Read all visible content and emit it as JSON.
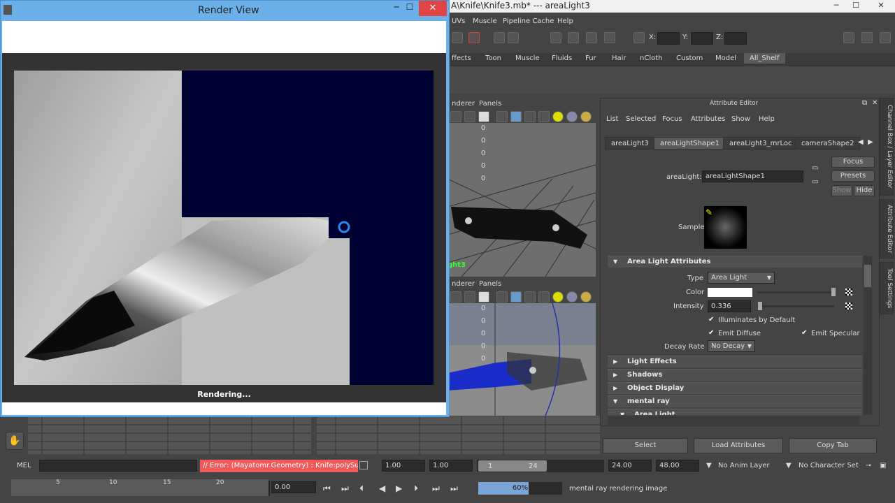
{
  "maya": {
    "title": "A\\Knife\\Knife3.mb*  ---  areaLight3",
    "menu": [
      "UVs",
      "Muscle",
      "Pipeline Cache",
      "Help"
    ],
    "xyz_labels": [
      "X:",
      "Y:",
      "Z:"
    ],
    "shelf_tabs": [
      "ffects",
      "Toon",
      "Muscle",
      "Fluids",
      "Fur",
      "Hair",
      "nCloth",
      "Custom",
      "Model",
      "All_Shelf"
    ]
  },
  "viewports": {
    "top": {
      "menu": [
        "nderer",
        "Panels"
      ],
      "label": "ght3",
      "values": [
        "0",
        "0",
        "0",
        "0",
        "0"
      ]
    },
    "bottom": {
      "menu": [
        "nderer",
        "Panels"
      ],
      "values": [
        "0",
        "0",
        "0",
        "0",
        "0"
      ]
    }
  },
  "attribute_editor": {
    "title": "Attribute Editor",
    "menu": [
      "List",
      "Selected",
      "Focus",
      "Attributes",
      "Show",
      "Help"
    ],
    "tabs": [
      "areaLight3",
      "areaLightShape1",
      "areaLight3_mrLoc",
      "cameraShape2"
    ],
    "node_label": "areaLight:",
    "node_value": "areaLightShape1",
    "focus_btn": "Focus",
    "presets_btn": "Presets",
    "show_btn": "Show",
    "hide_btn": "Hide",
    "sample_label": "Sample",
    "sections": {
      "area_light_attributes": "Area Light Attributes",
      "light_effects": "Light Effects",
      "shadows": "Shadows",
      "object_display": "Object Display",
      "mental_ray": "mental ray",
      "area_light": "Area Light"
    },
    "type_label": "Type",
    "type_value": "Area Light",
    "color_label": "Color",
    "color_value": "#ffffff",
    "intensity_label": "Intensity",
    "intensity_value": "0.336",
    "illuminates": "Illuminates by Default",
    "emit_diffuse": "Emit Diffuse",
    "emit_specular": "Emit Specular",
    "decay_label": "Decay Rate",
    "decay_value": "No Decay",
    "select_btn": "Select",
    "load_btn": "Load Attributes",
    "copy_btn": "Copy Tab"
  },
  "side_tabs": [
    "Channel Box / Layer Editor",
    "Attribute Editor",
    "Tool Settings"
  ],
  "timeline": {
    "ticks": [
      "5",
      "10",
      "15",
      "20"
    ]
  },
  "cmdline": {
    "mel_label": "MEL",
    "error": "// Error: (Mayatomr.Geometry) : Knife:polySurfac",
    "start1": "1.00",
    "start2": "1.00",
    "range_start": "1",
    "range_end": "24",
    "end1": "24.00",
    "end2": "48.00",
    "anim_layer": "No Anim Layer",
    "char_set": "No Character Set"
  },
  "rangebar": {
    "current_time": "0.00",
    "progress_text": "60%",
    "progress": 0.6,
    "status": "mental ray rendering image"
  },
  "render_view": {
    "title": "Render View",
    "status": "Rendering..."
  }
}
